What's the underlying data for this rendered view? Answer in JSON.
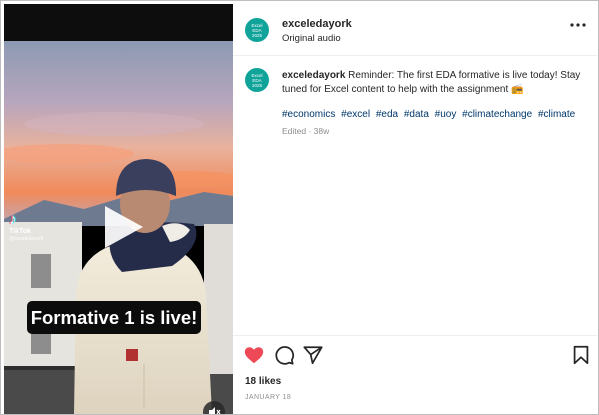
{
  "post": {
    "username": "exceledayork",
    "audio": "Original audio",
    "avatar_text": [
      "Excel",
      "EDA",
      "2025"
    ],
    "more_icon": "more-horizontal-icon"
  },
  "video": {
    "platform": "TikTok",
    "handle": "@exceledayork",
    "banner": "Formative 1 is live!",
    "play_icon": "play-icon",
    "mute_icon": "muted-speaker-icon"
  },
  "caption": {
    "username": "exceledayork",
    "text": "Reminder: The first EDA formative is live today! Stay tuned for Excel content to help with the assignment 📻",
    "hashtags": [
      "#economics",
      "#excel",
      "#eda",
      "#data",
      "#uoy",
      "#climatechange",
      "#climate"
    ],
    "meta": "Edited · 38w"
  },
  "actions": {
    "likes": "18 likes",
    "date": "JANUARY 18",
    "like_icon": "heart-icon",
    "comment_icon": "comment-icon",
    "share_icon": "send-icon",
    "save_icon": "bookmark-icon"
  },
  "colors": {
    "avatar": "#0fa39a",
    "like_active": "#ed4956",
    "hashtag": "#00376b",
    "muted_text": "#8e8e8e"
  }
}
